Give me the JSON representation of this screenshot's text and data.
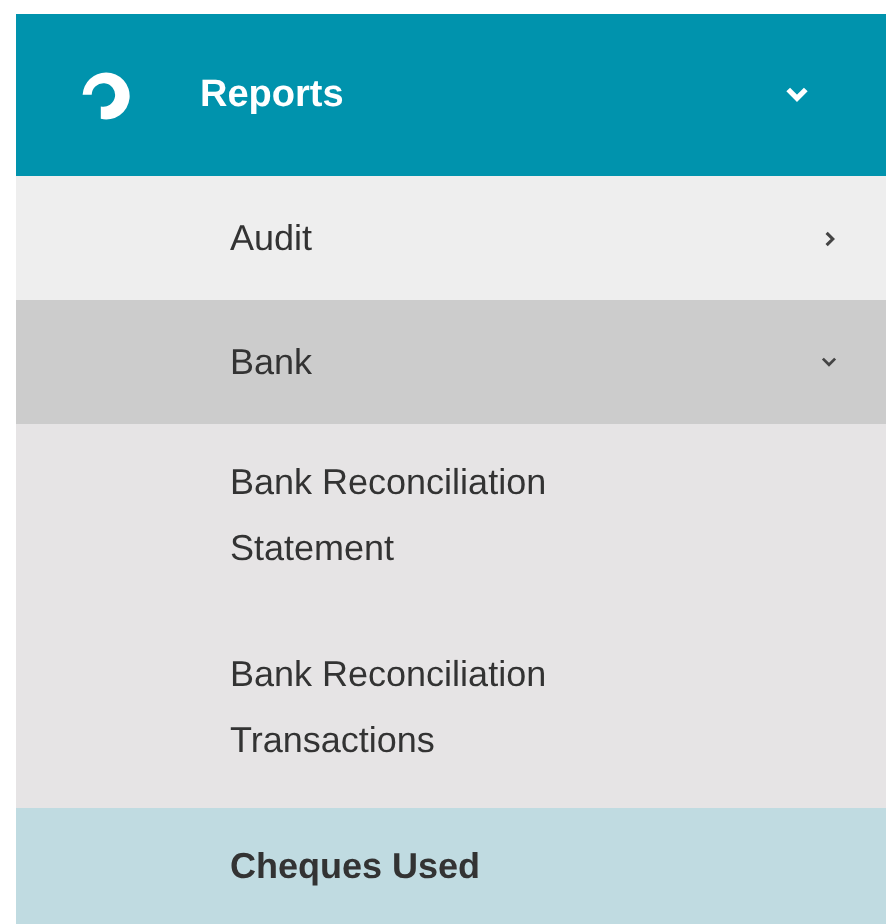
{
  "header": {
    "label": "Reports",
    "expanded": true
  },
  "items": [
    {
      "label": "Audit",
      "expanded": false
    },
    {
      "label": "Bank",
      "expanded": true,
      "children": [
        {
          "label": "Bank Reconciliation Statement",
          "selected": false
        },
        {
          "label": "Bank Reconciliation Transactions",
          "selected": false
        },
        {
          "label": "Cheques Used",
          "selected": true
        }
      ]
    }
  ]
}
